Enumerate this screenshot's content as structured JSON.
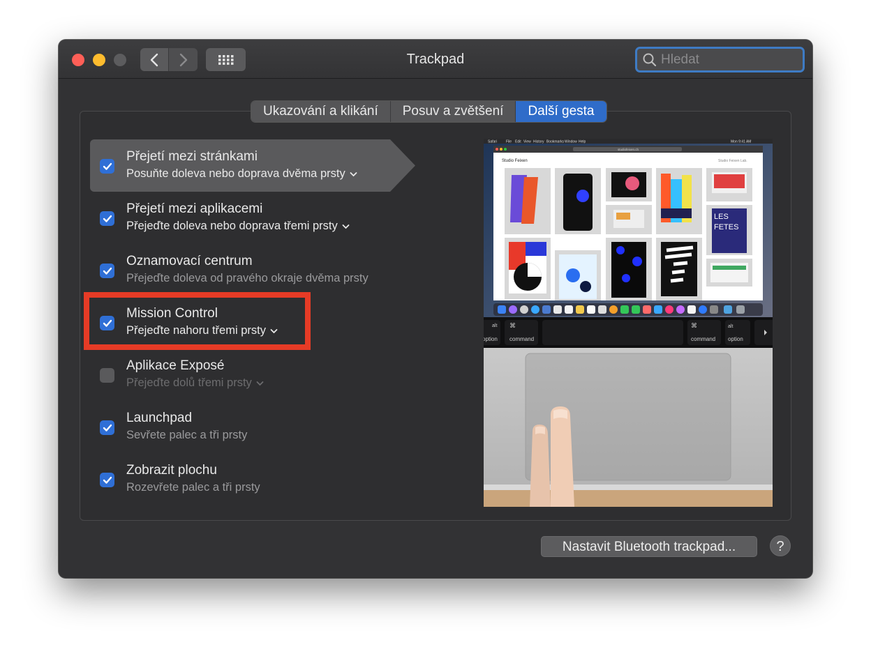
{
  "window": {
    "title": "Trackpad",
    "search_placeholder": "Hledat"
  },
  "tabs": [
    {
      "label": "Ukazování a klikání",
      "active": false
    },
    {
      "label": "Posuv a zvětšení",
      "active": false
    },
    {
      "label": "Další gesta",
      "active": true
    }
  ],
  "gestures": [
    {
      "title": "Přejetí mezi stránkami",
      "subtitle": "Posuňte doleva nebo doprava dvěma prsty",
      "checked": true,
      "has_menu": true
    },
    {
      "title": "Přejetí mezi aplikacemi",
      "subtitle": "Přejeďte doleva nebo doprava třemi prsty",
      "checked": true,
      "has_menu": true
    },
    {
      "title": "Oznamovací centrum",
      "subtitle": "Přejeďte doleva od pravého okraje dvěma prsty",
      "checked": true,
      "has_menu": false
    },
    {
      "title": "Mission Control",
      "subtitle": "Přejeďte nahoru třemi prsty",
      "checked": true,
      "has_menu": true
    },
    {
      "title": "Aplikace Exposé",
      "subtitle": "Přejeďte dolů třemi prsty",
      "checked": false,
      "has_menu": true
    },
    {
      "title": "Launchpad",
      "subtitle": "Sevřete palec a tři prsty",
      "checked": true,
      "has_menu": false
    },
    {
      "title": "Zobrazit plochu",
      "subtitle": "Rozevřete palec a tři prsty",
      "checked": true,
      "has_menu": false
    }
  ],
  "preview": {
    "menubar_items": [
      "Safari",
      "File",
      "Edit",
      "View",
      "History",
      "Bookmarks",
      "Window",
      "Help"
    ],
    "clock": "Mon 9:41 AM",
    "site_title": "Studio Feixen",
    "site_link": "Studio Feixen Lab.",
    "url": "studiofeixen.ch",
    "keys": [
      {
        "top": "alt",
        "bottom": "option"
      },
      {
        "top": "⌘",
        "bottom": "command"
      },
      {
        "top": "⌘",
        "bottom": "command"
      },
      {
        "top": "alt",
        "bottom": "option"
      }
    ]
  },
  "footer": {
    "bluetooth_label": "Nastavit Bluetooth trackpad...",
    "help_label": "?"
  },
  "colors": {
    "accent": "#2f6cc9",
    "highlight": "#e63b26",
    "close": "#fe5f57",
    "minimize": "#febc2e"
  }
}
